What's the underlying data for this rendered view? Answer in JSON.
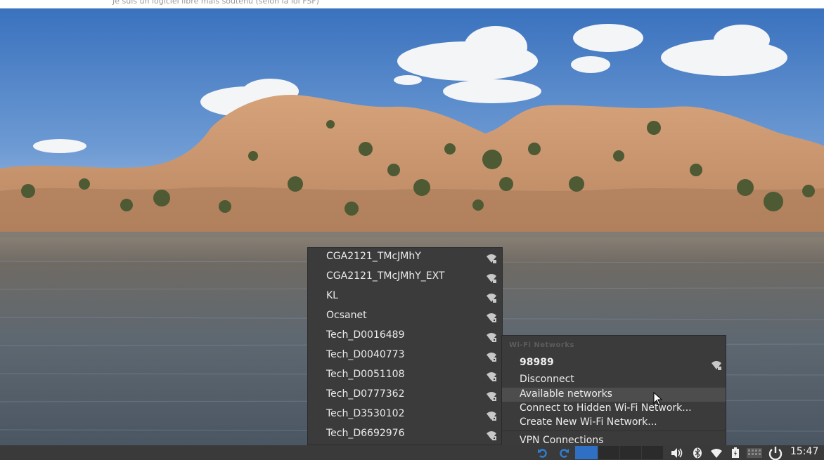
{
  "top_strip": {
    "text": "Je suis un logiciel libre mais soutenu (selon la loi FSF)"
  },
  "available_networks": [
    {
      "ssid": "CGA2121_TMcJMhY",
      "locked": false
    },
    {
      "ssid": "CGA2121_TMcJMhY_EXT",
      "locked": false
    },
    {
      "ssid": "KL",
      "locked": false
    },
    {
      "ssid": "Ocsanet",
      "locked": true
    },
    {
      "ssid": "Tech_D0016489",
      "locked": true
    },
    {
      "ssid": "Tech_D0040773",
      "locked": true
    },
    {
      "ssid": "Tech_D0051108",
      "locked": true
    },
    {
      "ssid": "Tech_D0777362",
      "locked": true
    },
    {
      "ssid": "Tech_D3530102",
      "locked": true
    },
    {
      "ssid": "Tech_D6692976",
      "locked": true
    }
  ],
  "wifi_menu": {
    "header": "Wi-Fi Networks",
    "connected_ssid": "98989",
    "disconnect": "Disconnect",
    "available_networks": "Available networks",
    "connect_hidden": "Connect to Hidden Wi-Fi Network...",
    "create_new": "Create New Wi-Fi Network...",
    "vpn": "VPN Connections"
  },
  "panel": {
    "clock": "15:47",
    "icons": [
      "undo-icon",
      "redo-icon",
      "workspace-switcher",
      "volume-icon",
      "bluetooth-icon",
      "wifi-icon",
      "battery-icon",
      "keyboard-icon",
      "power-icon"
    ]
  },
  "colors": {
    "menu_bg": "#3b3b3b",
    "menu_text": "#ececec",
    "highlight": "#4d4d4d",
    "panel_bg": "#3a3a3a",
    "workspace_active": "#2f6fc4"
  }
}
